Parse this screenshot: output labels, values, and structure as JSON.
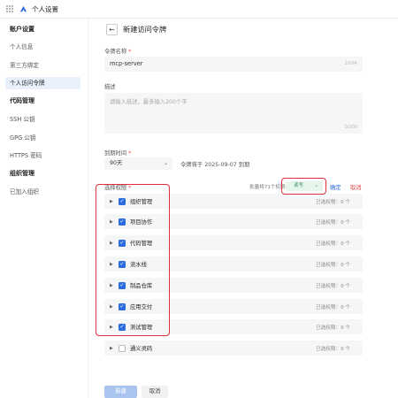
{
  "app": {
    "title": "个人设置"
  },
  "sidebar": {
    "groups": [
      {
        "title": "账户设置",
        "items": [
          "个人信息",
          "第三方绑定",
          "个人访问令牌"
        ]
      },
      {
        "title": "代码管理",
        "items": [
          "SSH 公钥",
          "GPG 公钥",
          "HTTPS 密码"
        ]
      },
      {
        "title": "组织管理",
        "items": [
          "已加入组织"
        ]
      }
    ],
    "active": "个人访问令牌"
  },
  "page": {
    "title": "新建访问令牌"
  },
  "form": {
    "name_label": "令牌名称",
    "name_value": "mcp-server",
    "name_counter": "10/64",
    "desc_label": "描述",
    "desc_placeholder": "请输入描述，最多输入200个字",
    "desc_counter": "0/200",
    "expire_label": "到期时间",
    "expire_value": "90天",
    "expire_note": "令牌将于 2025-09-07 到期",
    "perm_label": "选择权限",
    "required_mark": "*",
    "batch_label": "批量将71个权限改为",
    "batch_value": "读写",
    "confirm": "确定",
    "cancel": "取消",
    "permissions": [
      {
        "name": "组织管理",
        "count": "已选权限：0 个",
        "checked": true
      },
      {
        "name": "项目协作",
        "count": "已选权限：0 个",
        "checked": true
      },
      {
        "name": "代码管理",
        "count": "已选权限：0 个",
        "checked": true
      },
      {
        "name": "流水线",
        "count": "已选权限：0 个",
        "checked": true
      },
      {
        "name": "制品仓库",
        "count": "已选权限：0 个",
        "checked": true
      },
      {
        "name": "应用交付",
        "count": "已选权限：0 个",
        "checked": true
      },
      {
        "name": "测试管理",
        "count": "已选权限：0 个",
        "checked": true
      },
      {
        "name": "通义灵码",
        "count": "已选权限：0 个",
        "checked": false
      }
    ]
  },
  "footer": {
    "submit": "新建",
    "cancel": "取消"
  },
  "colors": {
    "accent": "#2d6cdf",
    "highlight": "#e0303a",
    "rw_badge": "#e6f6ec"
  }
}
